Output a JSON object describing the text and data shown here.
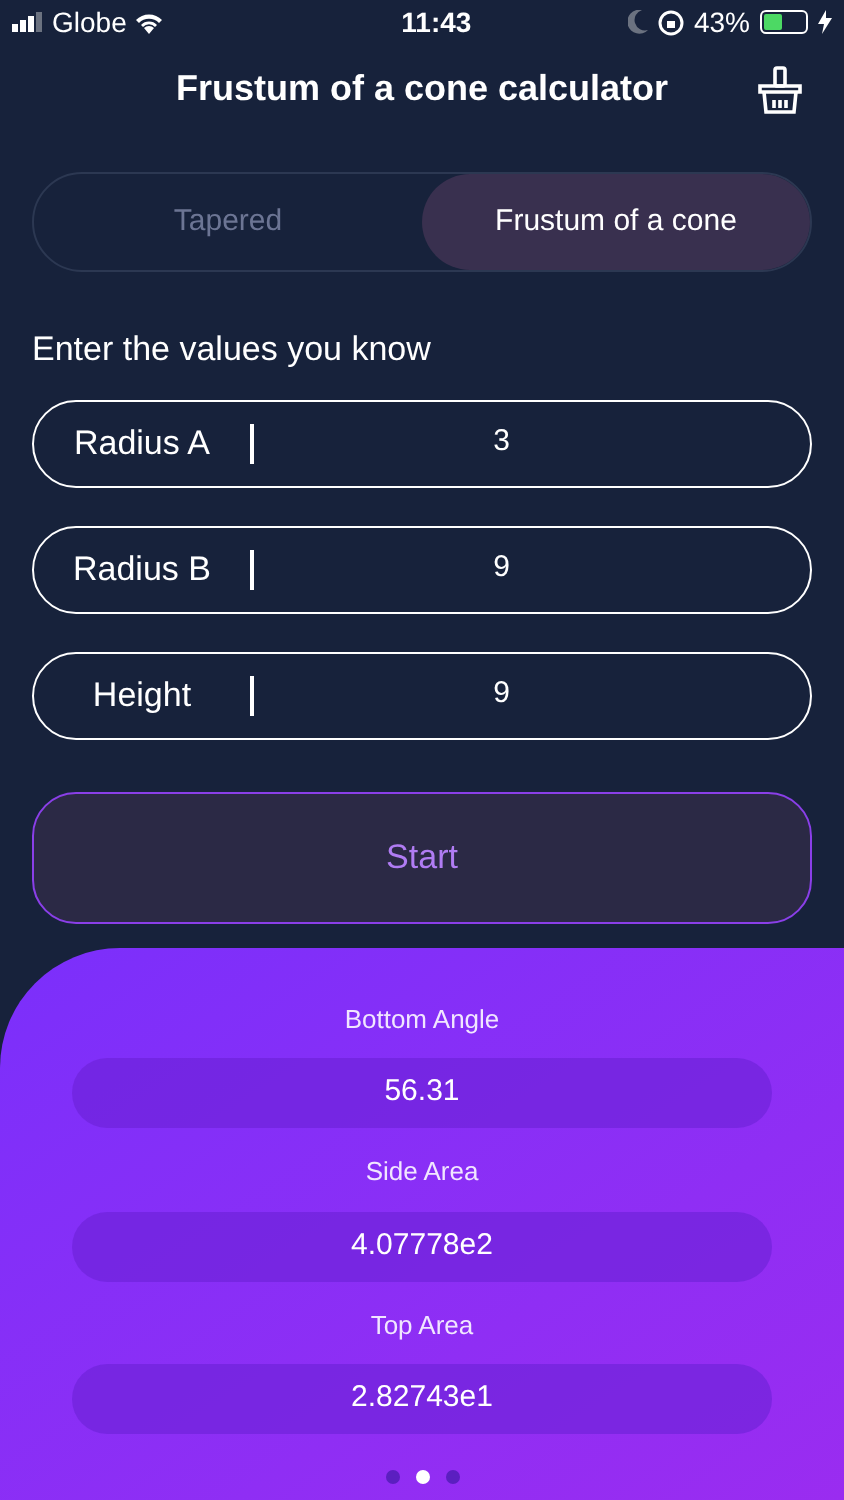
{
  "status_bar": {
    "carrier": "Globe",
    "time": "11:43",
    "battery_percent": "43%",
    "battery": {
      "level": 0.43
    }
  },
  "header": {
    "title": "Frustum of a cone calculator"
  },
  "segments": [
    {
      "label": "Tapered",
      "selected": false
    },
    {
      "label": "Frustum of a cone",
      "selected": true
    }
  ],
  "prompt": "Enter the values you know",
  "fields": [
    {
      "label": "Radius A",
      "value": "3"
    },
    {
      "label": "Radius B",
      "value": "9"
    },
    {
      "label": "Height",
      "value": "9"
    }
  ],
  "start_button": "Start",
  "results": [
    {
      "label": "Bottom Angle",
      "value": "56.31"
    },
    {
      "label": "Side Area",
      "value": "4.07778e2"
    },
    {
      "label": "Top Area",
      "value": "2.82743e1"
    }
  ],
  "page_dots": [
    {
      "selected": false
    },
    {
      "selected": true
    },
    {
      "selected": false
    }
  ]
}
